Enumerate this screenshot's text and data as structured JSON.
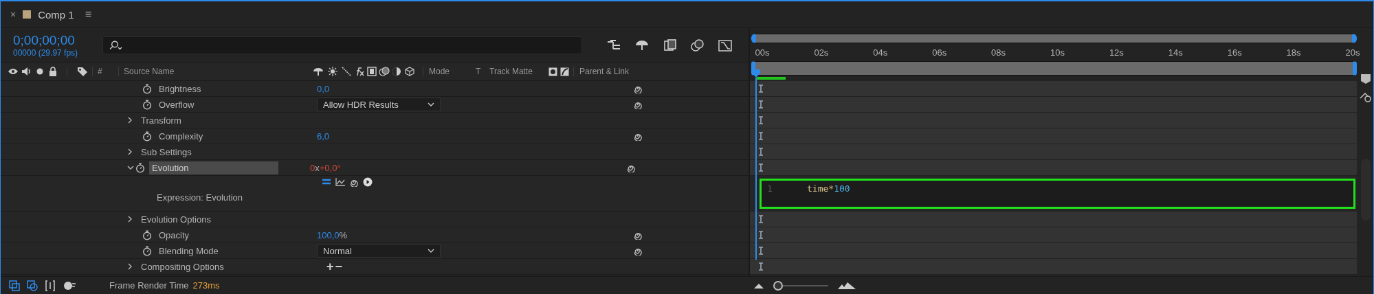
{
  "tab": {
    "title": "Comp 1",
    "menu": "≡",
    "close": "×"
  },
  "timecode": {
    "time": "0;00;00;00",
    "frames": "00000 (29.97 fps)"
  },
  "columns": {
    "number": "#",
    "source": "Source Name",
    "mode": "Mode",
    "t": "T",
    "track_matte": "Track Matte",
    "parent": "Parent & Link"
  },
  "rows": [
    {
      "kind": "property",
      "label": "Brightness",
      "selected": false,
      "expression": false,
      "value": [
        {
          "text": "0,0",
          "kind": "number"
        }
      ],
      "link": true
    },
    {
      "kind": "dropdown",
      "label": "Overflow",
      "selected": false,
      "value": "Allow HDR Results",
      "link": true
    },
    {
      "kind": "group",
      "label": "Transform",
      "expanded": false,
      "selected": false
    },
    {
      "kind": "property",
      "label": "Complexity",
      "selected": false,
      "expression": false,
      "value": [
        {
          "text": "6,0",
          "kind": "number"
        }
      ],
      "link": true
    },
    {
      "kind": "group",
      "label": "Sub Settings",
      "expanded": false,
      "selected": false
    },
    {
      "kind": "property",
      "label": "Evolution",
      "selected": true,
      "expanded": true,
      "expression": true,
      "value": [
        {
          "text": "0",
          "kind": "number"
        },
        {
          "text": "x",
          "kind": "unit"
        },
        {
          "text": "+0,0°",
          "kind": "number"
        }
      ],
      "link": true
    },
    {
      "kind": "expression",
      "label": "Expression: Evolution",
      "enabled": true,
      "code": [
        {
          "text": "time",
          "kind": "identifier"
        },
        {
          "text": "*",
          "kind": "operator"
        },
        {
          "text": "100",
          "kind": "number"
        }
      ],
      "line": "1"
    },
    {
      "kind": "group",
      "label": "Evolution Options",
      "expanded": false,
      "selected": false
    },
    {
      "kind": "property",
      "label": "Opacity",
      "selected": false,
      "expression": false,
      "value": [
        {
          "text": "100,0",
          "kind": "number"
        },
        {
          "text": "%",
          "kind": "unit"
        }
      ],
      "link": true
    },
    {
      "kind": "dropdown",
      "label": "Blending Mode",
      "selected": false,
      "value": "Normal",
      "link": true
    },
    {
      "kind": "group",
      "label": "Compositing Options",
      "expanded": false,
      "selected": false,
      "buttons": [
        "+",
        "−"
      ]
    }
  ],
  "ruler": {
    "ticks": [
      "00s",
      "02s",
      "04s",
      "06s",
      "08s",
      "10s",
      "12s",
      "14s",
      "16s",
      "18s",
      "20s"
    ]
  },
  "render_progress": {
    "level": 0.05
  },
  "zoom": {
    "level": 0
  },
  "status": {
    "label": "Frame Render Time",
    "value": "273ms"
  }
}
